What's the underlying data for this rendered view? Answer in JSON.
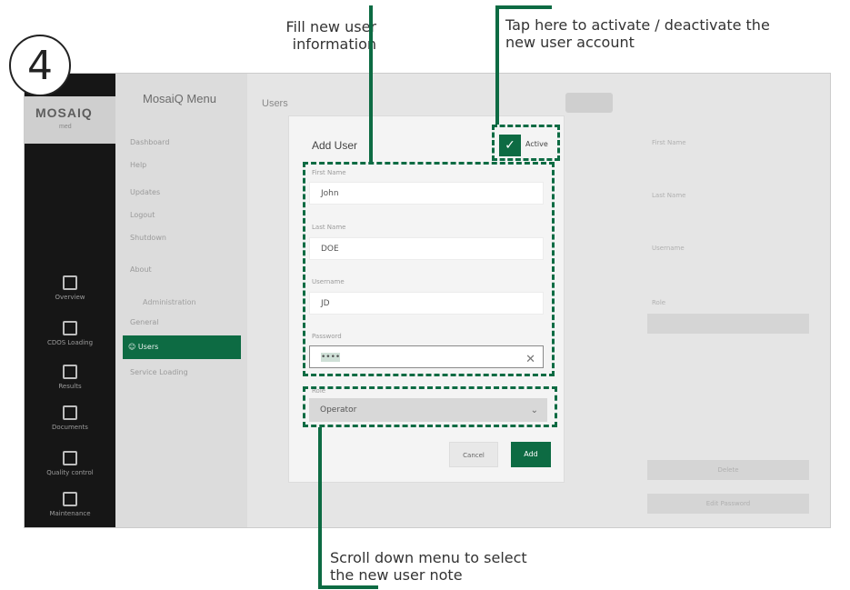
{
  "step": "4",
  "annotations": {
    "fill": "Fill  new user\ninformation",
    "active": "Tap here to activate / deactivate the\nnew user account",
    "scroll": "Scroll down menu to select\nthe new user note"
  },
  "app": {
    "logo": "MOSAIQ",
    "logo_sub": "med",
    "sidebar": [
      {
        "label": "Overview",
        "icon": "gauge-icon"
      },
      {
        "label": "CDOS Loading",
        "icon": "loader-icon"
      },
      {
        "label": "Results",
        "icon": "file-icon"
      },
      {
        "label": "Documents",
        "icon": "grid-icon"
      },
      {
        "label": "Quality control",
        "icon": "doc-check-icon"
      },
      {
        "label": "Maintenance",
        "icon": "wrench-icon"
      }
    ],
    "menu_title": "MosaiQ Menu",
    "menu_items": [
      "Dashboard",
      "Help",
      "Updates",
      "Logout",
      "Shutdown",
      "About"
    ],
    "admin_header": "Administration",
    "admin_items": [
      "General",
      "Users",
      "Service Loading"
    ],
    "page_title": "Users",
    "right_labels": [
      "First Name",
      "Last Name",
      "Username",
      "Role"
    ],
    "right_buttons": [
      "Delete",
      "Edit Password"
    ]
  },
  "modal": {
    "title": "Add User",
    "active_label": "Active",
    "first_name_label": "First Name",
    "first_name": "John",
    "last_name_label": "Last Name",
    "last_name": "DOE",
    "username_label": "Username",
    "username": "JD",
    "password_label": "Password",
    "password": "••••",
    "role_label": "Role",
    "role": "Operator",
    "cancel": "Cancel",
    "add": "Add"
  },
  "colors": {
    "accent": "#0d6b43",
    "sidebar": "#161616"
  }
}
